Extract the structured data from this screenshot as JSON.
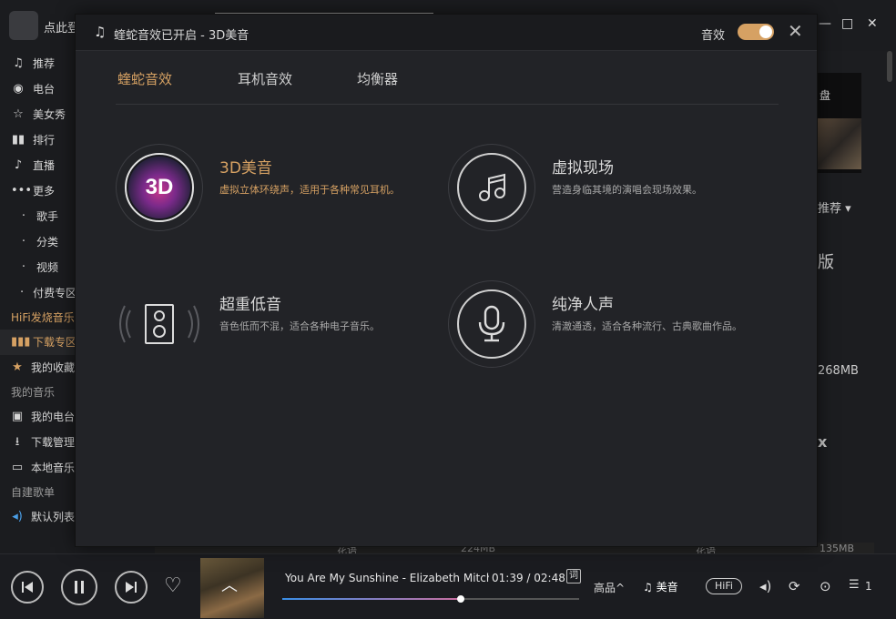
{
  "app": {
    "logo_text": "点此登",
    "window_controls": [
      "—",
      "□",
      "✕"
    ]
  },
  "sidebar": {
    "items": [
      {
        "label": "推荐",
        "icon": "♫"
      },
      {
        "label": "电台",
        "icon": "◉"
      },
      {
        "label": "美女秀",
        "icon": "☆"
      },
      {
        "label": "排行",
        "icon": "▮▮"
      },
      {
        "label": "直播",
        "icon": "♪"
      },
      {
        "label": "更多",
        "icon": "•••"
      }
    ],
    "sub_items": [
      "歌手",
      "分类",
      "视频",
      "付费专区"
    ],
    "hifi_section": "HiFi发烧音乐",
    "hifi_items": [
      {
        "label": "下载专区",
        "icon": "▮▮▮"
      },
      {
        "label": "我的收藏",
        "icon": "★"
      }
    ],
    "my_music_section": "我的音乐",
    "my_music_items": [
      {
        "label": "我的电台",
        "icon": "▣"
      },
      {
        "label": "下载管理",
        "icon": "⭳"
      },
      {
        "label": "本地音乐",
        "icon": "▭"
      }
    ],
    "playlist_section": "自建歌单",
    "playlist_items": [
      {
        "label": "默认列表",
        "icon": "◂)"
      }
    ]
  },
  "content_right": {
    "banner_text": "盘",
    "sort_label": "推荐",
    "text1": "版",
    "size1": "268MB",
    "text2": "x"
  },
  "bottom_peek": {
    "col1": "花语",
    "size1": "224MB",
    "col2": "花语",
    "size2": "135MB"
  },
  "player": {
    "song": "You Are My Sunshine - Elizabeth Mitchell",
    "current_time": "01:39",
    "total_time": "02:48",
    "lyric_btn": "词",
    "progress": 0.6,
    "quality": "高品",
    "effect_label": "美音",
    "hifi": "HiFi",
    "playlist_count": "1"
  },
  "dialog": {
    "title": "蝰蛇音效已开启 - 3D美音",
    "switch_label": "音效",
    "switch_on": true,
    "tabs": [
      "蝰蛇音效",
      "耳机音效",
      "均衡器"
    ],
    "active_tab": 0,
    "effects": [
      {
        "name": "3D美音",
        "desc": "虚拟立体环绕声，适用于各种常见耳机。",
        "icon": "3d-badge",
        "badge": "3D",
        "active": true
      },
      {
        "name": "虚拟现场",
        "desc": "营造身临其境的演唱会现场效果。",
        "icon": "music-note-icon",
        "active": false
      },
      {
        "name": "超重低音",
        "desc": "音色低而不混，适合各种电子音乐。",
        "icon": "speaker-icon",
        "active": false
      },
      {
        "name": "纯净人声",
        "desc": "清澈通透，适合各种流行、古典歌曲作品。",
        "icon": "microphone-icon",
        "active": false
      }
    ]
  },
  "colors": {
    "accent": "#d6a163",
    "bg": "#1c1d20",
    "dialog_bg": "#222327"
  }
}
